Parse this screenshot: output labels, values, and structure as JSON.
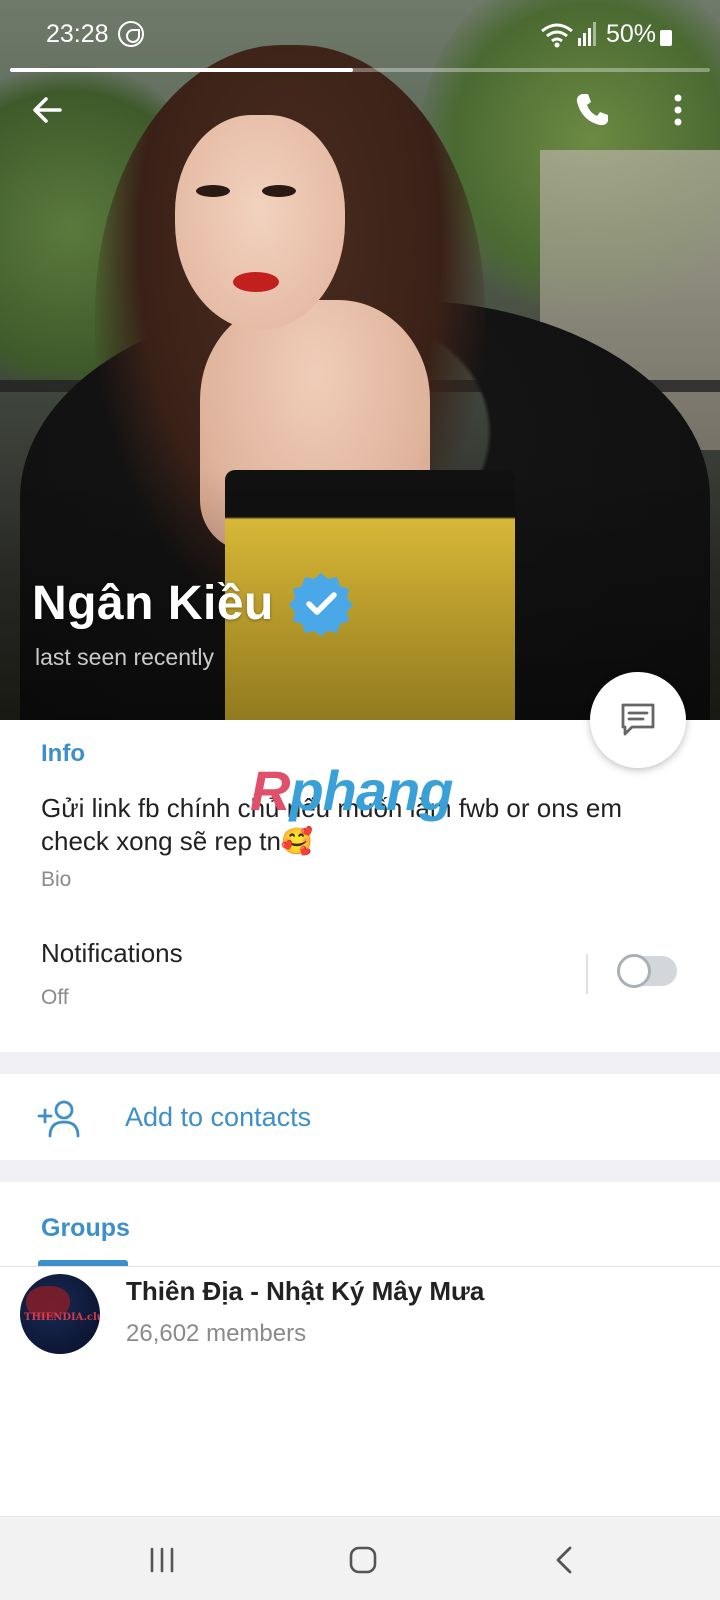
{
  "status_bar": {
    "time": "23:28",
    "battery": "50%",
    "story_progress": 0.49
  },
  "profile": {
    "name": "Ngân Kiều",
    "verified": true,
    "last_seen": "last seen recently"
  },
  "watermark": {
    "part1": "R",
    "part2": "phang"
  },
  "info": {
    "header": "Info",
    "bio": "Gửi link fb chính chủ nếu muốn làm fwb or ons em check xong sẽ rep tn🥰",
    "bio_label": "Bio",
    "notifications_label": "Notifications",
    "notifications_value": "Off"
  },
  "contacts": {
    "add_label": "Add to contacts"
  },
  "groups": {
    "tab_label": "Groups",
    "items": [
      {
        "name": "Thiên Địa - Nhật Ký Mây Mưa",
        "members": "26,602 members",
        "avatar_text": "THIENDIA.club"
      }
    ]
  },
  "colors": {
    "accent": "#3d8fcc",
    "verified": "#4aa8e8",
    "divider": "#efeff4"
  },
  "icons": {
    "back": "back-arrow-icon",
    "call": "phone-icon",
    "more": "more-vertical-icon",
    "verified": "verified-badge-icon",
    "message": "message-icon",
    "add_contact": "add-user-icon"
  }
}
